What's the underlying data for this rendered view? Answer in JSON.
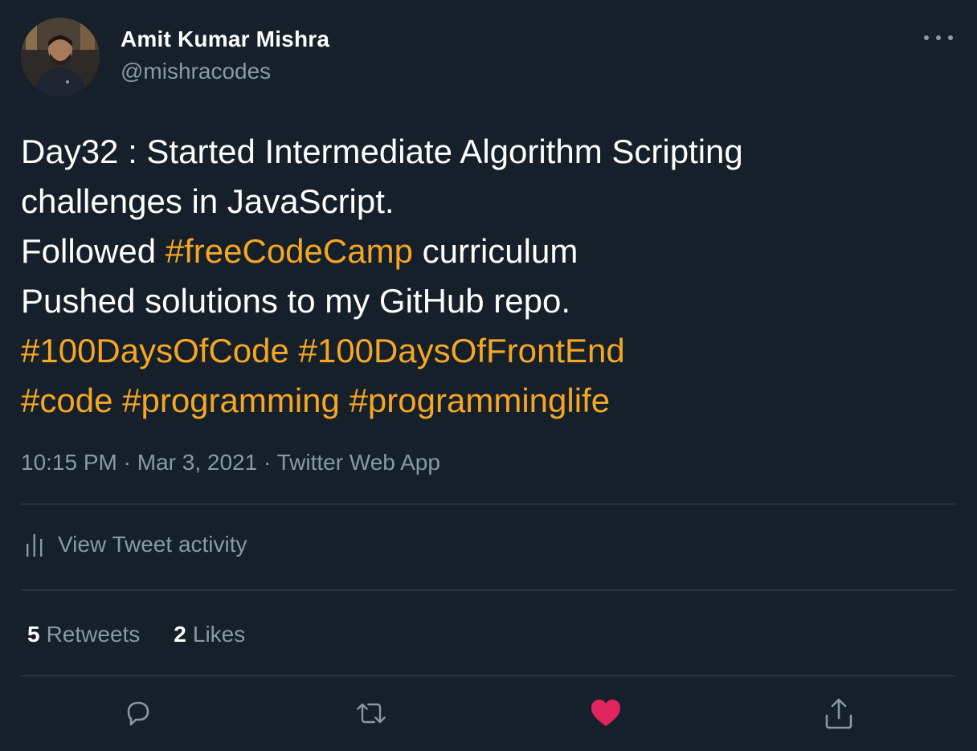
{
  "user": {
    "display_name": "Amit Kumar Mishra",
    "handle": "@mishracodes",
    "avatar_icon": "user-avatar-photo"
  },
  "tweet": {
    "lines": [
      [
        {
          "text": "Day32 : Started Intermediate Algorithm Scripting",
          "hashtag": false
        }
      ],
      [
        {
          "text": "challenges in JavaScript.",
          "hashtag": false
        }
      ],
      [
        {
          "text": "Followed ",
          "hashtag": false
        },
        {
          "text": "#freeCodeCamp",
          "hashtag": true
        },
        {
          "text": " curriculum",
          "hashtag": false
        }
      ],
      [
        {
          "text": "Pushed solutions to my GitHub repo.",
          "hashtag": false
        }
      ],
      [
        {
          "text": "#100DaysOfCode",
          "hashtag": true
        },
        {
          "text": " ",
          "hashtag": false
        },
        {
          "text": "#100DaysOfFrontEnd",
          "hashtag": true
        }
      ],
      [
        {
          "text": "#code",
          "hashtag": true
        },
        {
          "text": " ",
          "hashtag": false
        },
        {
          "text": "#programming",
          "hashtag": true
        },
        {
          "text": " ",
          "hashtag": false
        },
        {
          "text": "#programminglife",
          "hashtag": true
        }
      ]
    ],
    "time": "10:15 PM",
    "separator": " · ",
    "date": "Mar 3, 2021",
    "source": "Twitter Web App"
  },
  "activity": {
    "label": "View Tweet activity",
    "icon": "bar-chart-icon"
  },
  "stats": {
    "retweets_count": "5",
    "retweets_label": "Retweets",
    "likes_count": "2",
    "likes_label": "Likes"
  },
  "actions": {
    "reply_icon": "reply-icon",
    "retweet_icon": "retweet-icon",
    "like_icon": "heart-icon",
    "share_icon": "share-icon"
  },
  "colors": {
    "background": "#15202b",
    "hashtag": "#f5a623",
    "secondary_text": "#8899a6",
    "divider": "#38444d",
    "liked": "#e0245e"
  }
}
